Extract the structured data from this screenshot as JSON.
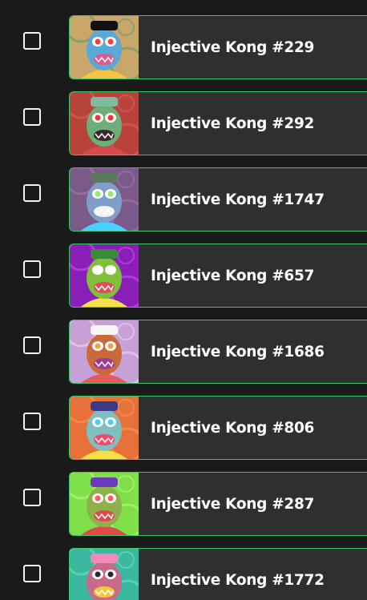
{
  "items": [
    {
      "name": "Injective Kong #229",
      "bg": "#c9a76b",
      "bg2": "#8aa06a",
      "face": "#5aa8d8",
      "mouth": "#e05a8a",
      "eye": "#ff3b3b",
      "hat": "#111111",
      "accent": "#f5c542"
    },
    {
      "name": "Injective Kong #292",
      "bg": "#b8433b",
      "bg2": "#c8584e",
      "face": "#6fae7a",
      "mouth": "#3a2a2a",
      "eye": "#ff3030",
      "hat": "#7fb9a0",
      "accent": "#d64a4a"
    },
    {
      "name": "Injective Kong #1747",
      "bg": "#7a5a8a",
      "bg2": "#9a6a9a",
      "face": "#7f9fc8",
      "mouth": "#f2f2f2",
      "eye": "#8cf06a",
      "hat": "#5a7a5a",
      "accent": "#4ad0ff"
    },
    {
      "name": "Injective Kong #657",
      "bg": "#8a1fb8",
      "bg2": "#b43ad6",
      "face": "#7fbf3a",
      "mouth": "#e04a5a",
      "eye": "#ffffff",
      "hat": "#3a8a3a",
      "accent": "#f5e04a"
    },
    {
      "name": "Injective Kong #1686",
      "bg": "#c8a0d8",
      "bg2": "#e0c0e8",
      "face": "#c86a3a",
      "mouth": "#a03a9a",
      "eye": "#f5a03a",
      "hat": "#f5f5f5",
      "accent": "#e85a5a"
    },
    {
      "name": "Injective Kong #806",
      "bg": "#e8703a",
      "bg2": "#f08a4a",
      "face": "#7fbfbf",
      "mouth": "#f04a6a",
      "eye": "#3ad0ff",
      "hat": "#3a3a8a",
      "accent": "#f5e04a"
    },
    {
      "name": "Injective Kong #287",
      "bg": "#7fe04a",
      "bg2": "#a0f06a",
      "face": "#8fb04a",
      "mouth": "#e04a4a",
      "eye": "#ff5a5a",
      "hat": "#6a3ab8",
      "accent": "#e04a4a"
    },
    {
      "name": "Injective Kong #1772",
      "bg": "#3ab8a0",
      "bg2": "#5ad0b8",
      "face": "#c86a8a",
      "mouth": "#f5c53a",
      "eye": "#2a2a2a",
      "hat": "#f08ab8",
      "accent": "#f5a03a"
    }
  ]
}
